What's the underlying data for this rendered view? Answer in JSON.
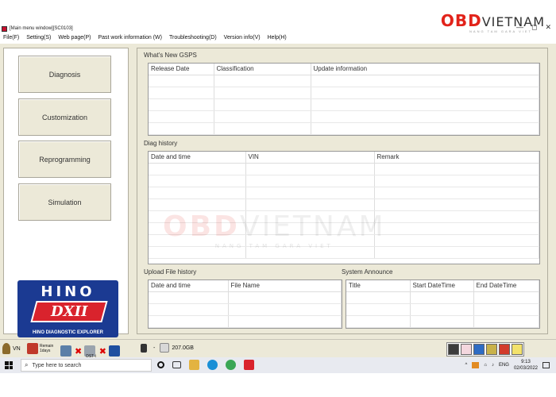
{
  "window": {
    "title": "[Main menu window][SC0103]",
    "brand_red": "OBD",
    "brand_dark": "VIETNAM",
    "brand_sub": "NANG TAM GARA VIET",
    "controls": [
      "—",
      "◻",
      "✕"
    ]
  },
  "menu": [
    "File(F)",
    "Setting(S)",
    "Web page(P)",
    "Past work information (W)",
    "Troubleshooting(D)",
    "Version info(V)",
    "Help(H)"
  ],
  "sidebar": {
    "buttons": [
      "Diagnosis",
      "Customization",
      "Reprogramming",
      "Simulation"
    ],
    "logo": {
      "brand": "HINO",
      "product": "DXII",
      "tagline": "HINO DIAGNOSTIC EXPLORER"
    }
  },
  "sections": {
    "whats_new": {
      "title": "What's New GSPS",
      "columns": [
        "Release Date",
        "Classification",
        "Update information"
      ]
    },
    "diag_history": {
      "title": "Diag history",
      "columns": [
        "Date and time",
        "VIN",
        "Remark"
      ]
    },
    "upload_history": {
      "title": "Upload File history",
      "columns": [
        "Date and time",
        "File Name"
      ]
    },
    "system_announce": {
      "title": "System Announce",
      "columns": [
        "Title",
        "Start DateTime",
        "End DateTime"
      ]
    }
  },
  "watermark": {
    "red": "OBD",
    "gray": "VIETNAM",
    "sub": "NANG TAM GARA VIET"
  },
  "status": {
    "vin_label": "VN",
    "remain": "Remain 1days",
    "dst_label": "DST-i",
    "dash": "-",
    "disk": "207.0GB"
  },
  "taskbar": {
    "search_placeholder": "Type here to search",
    "lang": "ENG",
    "time": "9:13",
    "date": "02/03/2022"
  },
  "colors": {
    "accent_red": "#e2231a",
    "logo_blue": "#1b3a92",
    "panel_bg": "#ece9d8"
  }
}
